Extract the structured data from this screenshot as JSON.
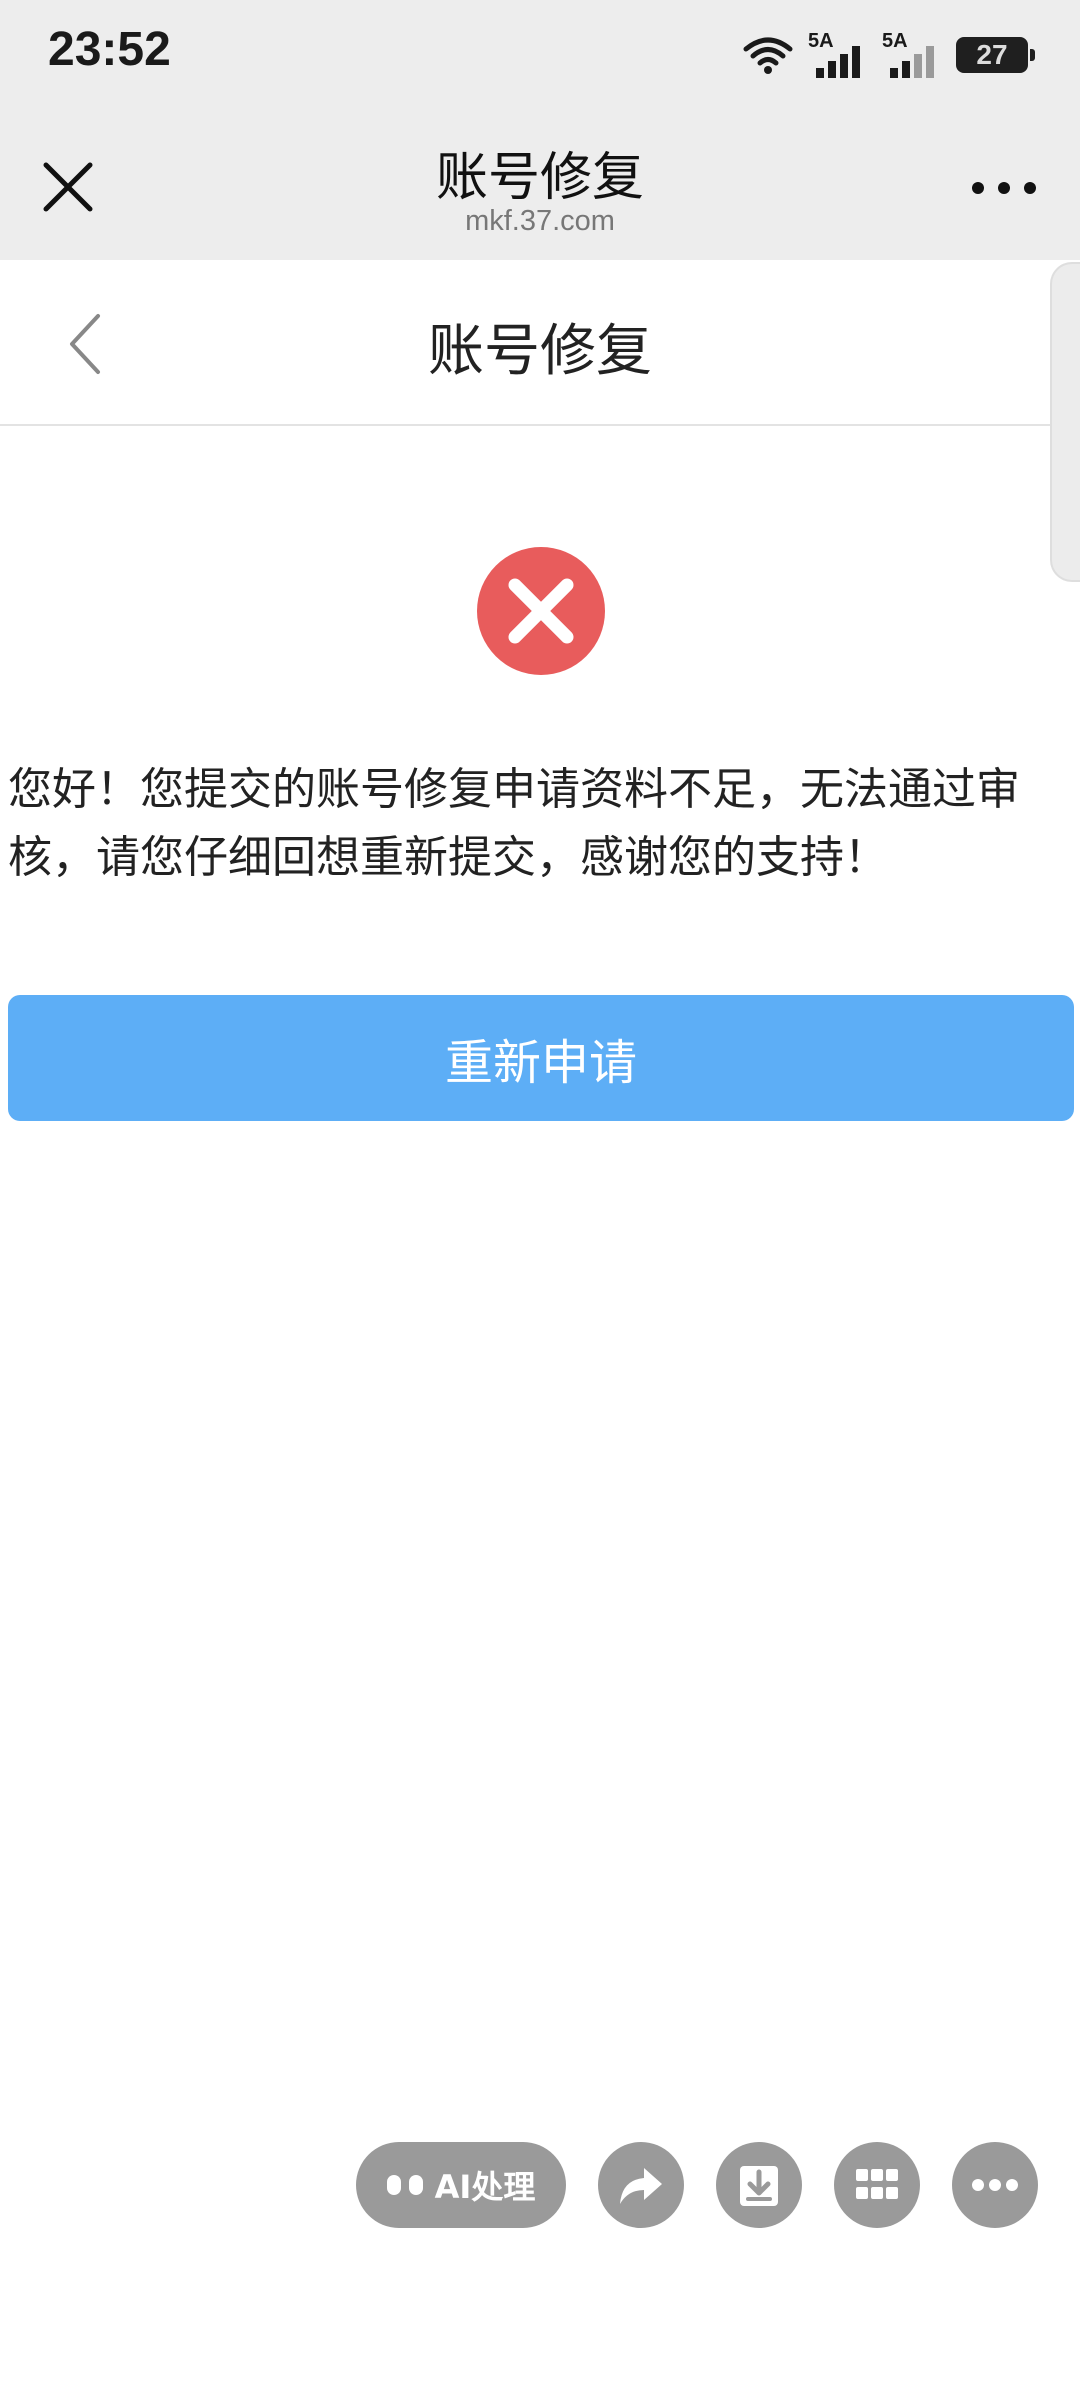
{
  "status_bar": {
    "time": "23:52",
    "battery": "27",
    "signal_1_label": "5A",
    "signal_2_label": "5A",
    "icons": [
      "wifi-icon",
      "signal-icon",
      "signal-icon",
      "battery-icon"
    ]
  },
  "browser": {
    "title": "账号修复",
    "url": "mkf.37.com",
    "close_icon": "close-icon",
    "more_icon": "more-icon"
  },
  "page": {
    "title": "账号修复",
    "back_icon": "chevron-left-icon"
  },
  "result": {
    "icon": "error-icon",
    "message": "您好！您提交的账号修复申请资料不足，无法通过审核，请您仔细回想重新提交，感谢您的支持！",
    "retry_label": "重新申请",
    "accent_color": "#5daef6",
    "error_color": "#e85c5c"
  },
  "toolbar": {
    "ai_label": "AI处理",
    "buttons": [
      "share-icon",
      "download-icon",
      "apps-icon",
      "more-icon"
    ]
  }
}
